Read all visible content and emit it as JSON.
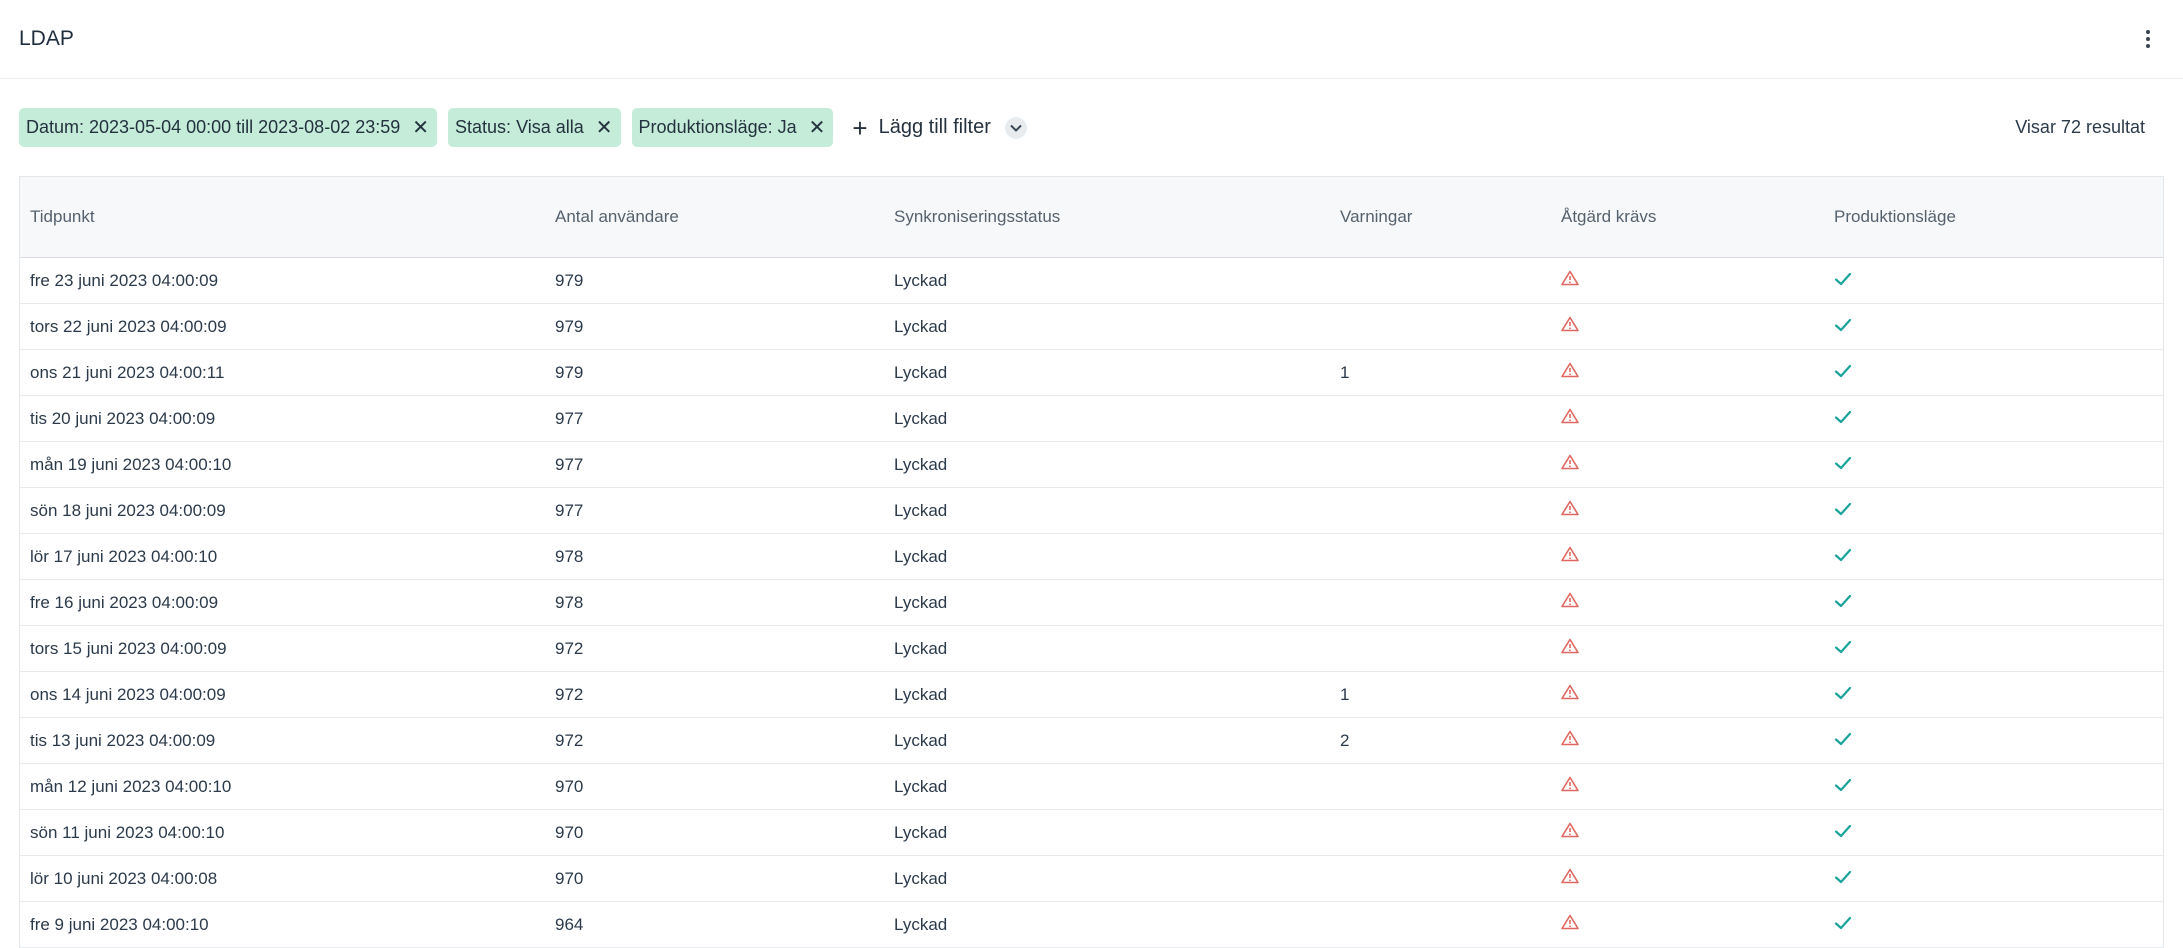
{
  "app": {
    "title": "LDAP"
  },
  "filters": [
    {
      "label": "Datum: 2023-05-04 00:00 till 2023-08-02 23:59"
    },
    {
      "label": "Status: Visa alla"
    },
    {
      "label": "Produktionsläge: Ja"
    }
  ],
  "add_filter_label": "Lägg till filter",
  "result_count": "Visar 72 resultat",
  "columns": [
    "Tidpunkt",
    "Antal användare",
    "Synkroniseringsstatus",
    "Varningar",
    "Åtgärd krävs",
    "Produktionsläge"
  ],
  "rows": [
    {
      "time": "fre 23 juni 2023 04:00:09",
      "users": "979",
      "status": "Lyckad",
      "warnings": ""
    },
    {
      "time": "tors 22 juni 2023 04:00:09",
      "users": "979",
      "status": "Lyckad",
      "warnings": ""
    },
    {
      "time": "ons 21 juni 2023 04:00:11",
      "users": "979",
      "status": "Lyckad",
      "warnings": "1"
    },
    {
      "time": "tis 20 juni 2023 04:00:09",
      "users": "977",
      "status": "Lyckad",
      "warnings": ""
    },
    {
      "time": "mån 19 juni 2023 04:00:10",
      "users": "977",
      "status": "Lyckad",
      "warnings": ""
    },
    {
      "time": "sön 18 juni 2023 04:00:09",
      "users": "977",
      "status": "Lyckad",
      "warnings": ""
    },
    {
      "time": "lör 17 juni 2023 04:00:10",
      "users": "978",
      "status": "Lyckad",
      "warnings": ""
    },
    {
      "time": "fre 16 juni 2023 04:00:09",
      "users": "978",
      "status": "Lyckad",
      "warnings": ""
    },
    {
      "time": "tors 15 juni 2023 04:00:09",
      "users": "972",
      "status": "Lyckad",
      "warnings": ""
    },
    {
      "time": "ons 14 juni 2023 04:00:09",
      "users": "972",
      "status": "Lyckad",
      "warnings": "1"
    },
    {
      "time": "tis 13 juni 2023 04:00:09",
      "users": "972",
      "status": "Lyckad",
      "warnings": "2"
    },
    {
      "time": "mån 12 juni 2023 04:00:10",
      "users": "970",
      "status": "Lyckad",
      "warnings": ""
    },
    {
      "time": "sön 11 juni 2023 04:00:10",
      "users": "970",
      "status": "Lyckad",
      "warnings": ""
    },
    {
      "time": "lör 10 juni 2023 04:00:08",
      "users": "970",
      "status": "Lyckad",
      "warnings": ""
    },
    {
      "time": "fre 9 juni 2023 04:00:10",
      "users": "964",
      "status": "Lyckad",
      "warnings": ""
    }
  ],
  "icons": {
    "action_required": "warning-triangle-icon",
    "production": "check-icon",
    "remove_filter": "close-icon",
    "menu": "kebab-menu-icon"
  },
  "colors": {
    "chip_bg": "#c4ecd9",
    "warning": "#e0675f",
    "check": "#1aa39a"
  }
}
